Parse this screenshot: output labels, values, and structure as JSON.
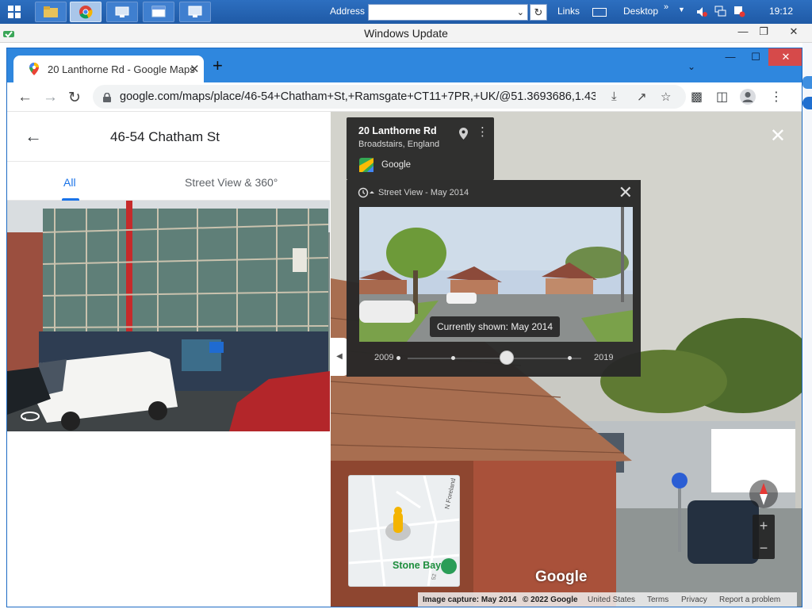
{
  "taskbar": {
    "address_label": "Address",
    "links_label": "Links",
    "desktop_label": "Desktop",
    "chevron": "»",
    "clock": "19:12"
  },
  "update_window": {
    "title": "Windows Update"
  },
  "browser": {
    "tab_title": "20 Lanthorne Rd - Google Maps",
    "url": "google.com/maps/place/46-54+Chatham+St,+Ramsgate+CT11+7PR,+UK/@51.3693686,1.4391..."
  },
  "panel": {
    "title": "46-54 Chatham St",
    "tabs": [
      "All",
      "Street View & 360°"
    ]
  },
  "street_view": {
    "address_title": "20 Lanthorne Rd",
    "address_sub": "Broadstairs, England",
    "source": "Google",
    "timeline_header": "Street View - May 2014",
    "currently_shown": "Currently shown: May 2014",
    "year_start": "2009",
    "year_end": "2019",
    "map_label": "Stone Bay",
    "map_road": "N Foreland",
    "map_road_number": "52",
    "watermark": "Google"
  },
  "attribution": {
    "capture": "Image capture: May 2014",
    "copyright": "© 2022 Google",
    "region": "United States",
    "terms": "Terms",
    "privacy": "Privacy",
    "report": "Report a problem"
  }
}
